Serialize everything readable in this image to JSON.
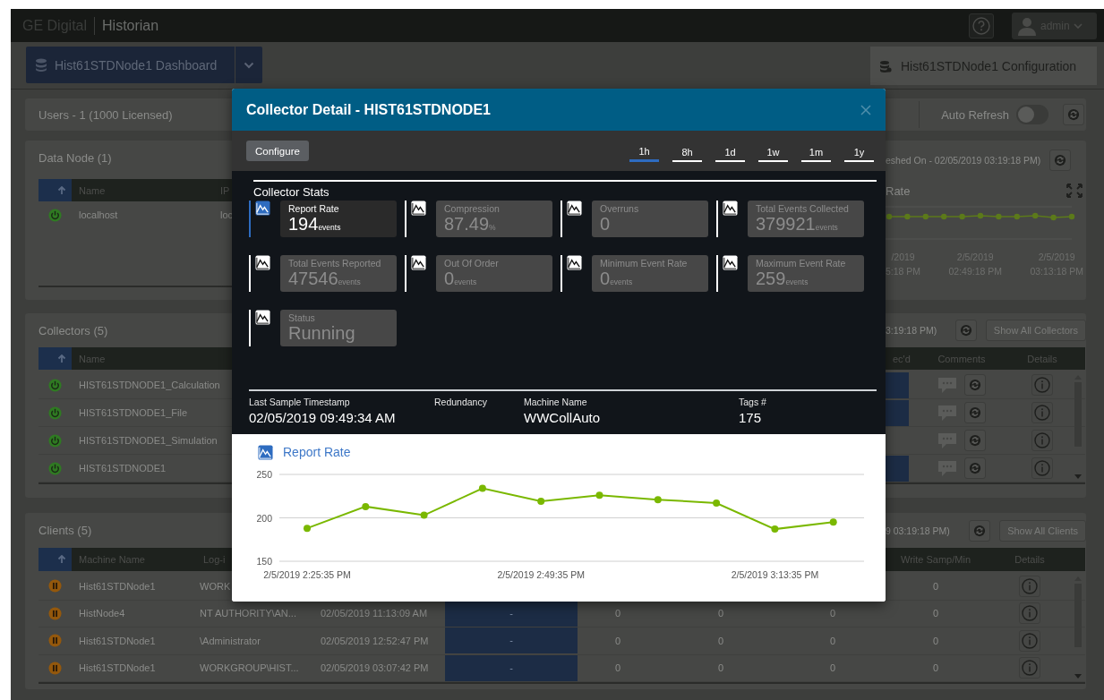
{
  "app_bar": {
    "brand": "GE Digital",
    "product": "Historian",
    "user": "admin"
  },
  "nav": {
    "dashboard": "Hist61STDNode1 Dashboard",
    "configuration": "Hist61STDNode1 Configuration"
  },
  "users_panel": {
    "title": "Users - 1 (1000 Licensed)",
    "auto_refresh_label": "Auto Refresh",
    "auto_refresh_on": false
  },
  "data_node_panel": {
    "title": "Data Node (1)",
    "columns": {
      "name": "Name",
      "ip": "IP"
    },
    "rows": [
      {
        "name": "localhost",
        "ip": "loc"
      }
    ],
    "refreshed": "eshed On - 02/05/2019 03:19:18 PM)",
    "chart_title": "Rate",
    "x_labels": [
      {
        "date": "/2019",
        "time": "5:18 PM"
      },
      {
        "date": "2/5/2019",
        "time": "02:49:18 PM"
      },
      {
        "date": "2/5/2019",
        "time": "03:13:18 PM"
      }
    ]
  },
  "collectors_panel": {
    "title": "Collectors (5)",
    "refreshed": "3:19:18 PM)",
    "show_all": "Show All Collectors",
    "columns": {
      "name": "Name",
      "column_rec": "ec'd",
      "comments": "Comments",
      "details": "Details"
    },
    "rows": [
      {
        "name": "HIST61STDNODE1_Calculation",
        "highlighted": true
      },
      {
        "name": "HIST61STDNODE1_File",
        "highlighted": true
      },
      {
        "name": "HIST61STDNODE1_Simulation",
        "highlighted": false
      },
      {
        "name": "HIST61STDNODE1",
        "highlighted": true
      }
    ]
  },
  "clients_panel": {
    "title": "Clients (5)",
    "refreshed": "9 03:19:18 PM)",
    "show_all": "Show All Clients",
    "columns": {
      "machine_name": "Machine Name",
      "login": "Log-i",
      "write": "Write Samp/Min",
      "details": "Details"
    },
    "rows": [
      {
        "machine_name": "Hist61STDNode1",
        "login": "WORK",
        "write": "0"
      },
      {
        "machine_name": "HistNode4",
        "login": "NT AUTHORITY\\AN...",
        "timestamp": "02/05/2019 11:13:09 AM",
        "column_5": "-",
        "column_6": "0",
        "column_7": "0",
        "column_8": "0",
        "write": "0"
      },
      {
        "machine_name": "Hist61STDNode1",
        "login": "\\Administrator",
        "timestamp": "02/05/2019 12:52:47 PM",
        "column_5": "-",
        "column_6": "0",
        "column_7": "0",
        "column_8": "0",
        "write": "0"
      },
      {
        "machine_name": "Hist61STDNode1",
        "login": "WORKGROUP\\HIST...",
        "timestamp": "02/05/2019 03:07:42 PM",
        "column_5": "-",
        "column_6": "0",
        "column_7": "0",
        "column_8": "0",
        "write": "0"
      }
    ]
  },
  "dialog": {
    "title": "Collector Detail - HIST61STDNODE1",
    "configure": "Configure",
    "ranges": [
      {
        "label": "1h",
        "selected": true
      },
      {
        "label": "8h",
        "selected": false
      },
      {
        "label": "1d",
        "selected": false
      },
      {
        "label": "1w",
        "selected": false
      },
      {
        "label": "1m",
        "selected": false
      },
      {
        "label": "1y",
        "selected": false
      }
    ],
    "stats_title": "Collector Stats",
    "stats": [
      {
        "label": "Report Rate",
        "value": "194",
        "unit": "events",
        "selected": true
      },
      {
        "label": "Compression",
        "value": "87.49",
        "unit": "%",
        "selected": false
      },
      {
        "label": "Overruns",
        "value": "0",
        "selected": false
      },
      {
        "label": "Total Events Collected",
        "value": "379921",
        "unit": "events",
        "selected": false
      },
      {
        "label": "Total Events Reported",
        "value": "47546",
        "unit": "events",
        "selected": false
      },
      {
        "label": "Out Of Order",
        "value": "0",
        "unit": "events",
        "selected": false
      },
      {
        "label": "Minimum Event Rate",
        "value": "0",
        "unit": "events",
        "selected": false
      },
      {
        "label": "Maximum Event Rate",
        "value": "259",
        "unit": "events",
        "selected": false
      },
      {
        "label": "Status",
        "value": "Running",
        "selected": false
      }
    ],
    "info": [
      {
        "label": "Last Sample Timestamp",
        "value": "02/05/2019 09:49:34 AM"
      },
      {
        "label": "Redundancy"
      },
      {
        "label": "Machine Name",
        "value": "WWCollAuto"
      },
      {
        "label": "Tags #",
        "value": "175"
      }
    ],
    "chart_data": {
      "type": "line",
      "title": "Report Rate",
      "categories": [
        "2/5/2019 2:25:35 PM",
        null,
        null,
        null,
        "2/5/2019 2:49:35 PM",
        null,
        null,
        null,
        "2/5/2019 3:13:35 PM",
        null
      ],
      "series": [
        {
          "color": "#7ab800",
          "marker": true,
          "values": [
            188,
            213,
            203,
            234,
            219,
            226,
            221,
            217,
            187,
            195
          ]
        }
      ],
      "ylim": [
        150,
        250
      ],
      "yticks": [
        150,
        200,
        250
      ]
    }
  }
}
